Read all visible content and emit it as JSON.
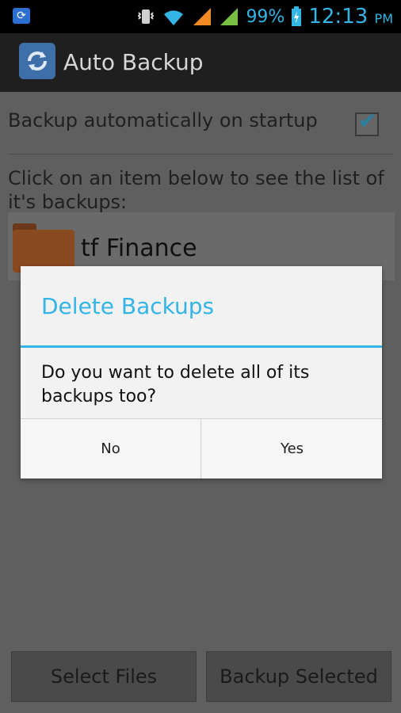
{
  "status_bar": {
    "battery_percent": "99%",
    "time": "12:13",
    "time_suffix": "PM",
    "icons": [
      "app-sync-icon",
      "vibrate-icon",
      "wifi-icon",
      "signal-orange-icon",
      "signal-green-icon",
      "battery-charging-icon"
    ]
  },
  "action_bar": {
    "title": "Auto Backup",
    "icon": "sync-icon"
  },
  "settings": {
    "auto_backup_label": "Backup automatically on startup",
    "auto_backup_checked": true
  },
  "hint_text": "Click on an item below to see the list of it's backups:",
  "items": [
    {
      "label": "tf Finance",
      "icon": "folder-icon"
    }
  ],
  "buttons": {
    "select_files": "Select Files",
    "backup_selected": "Backup Selected"
  },
  "dialog": {
    "title": "Delete Backups",
    "message": "Do you want to delete all of its backups too?",
    "no_label": "No",
    "yes_label": "Yes"
  },
  "colors": {
    "accent": "#33b5e5"
  }
}
